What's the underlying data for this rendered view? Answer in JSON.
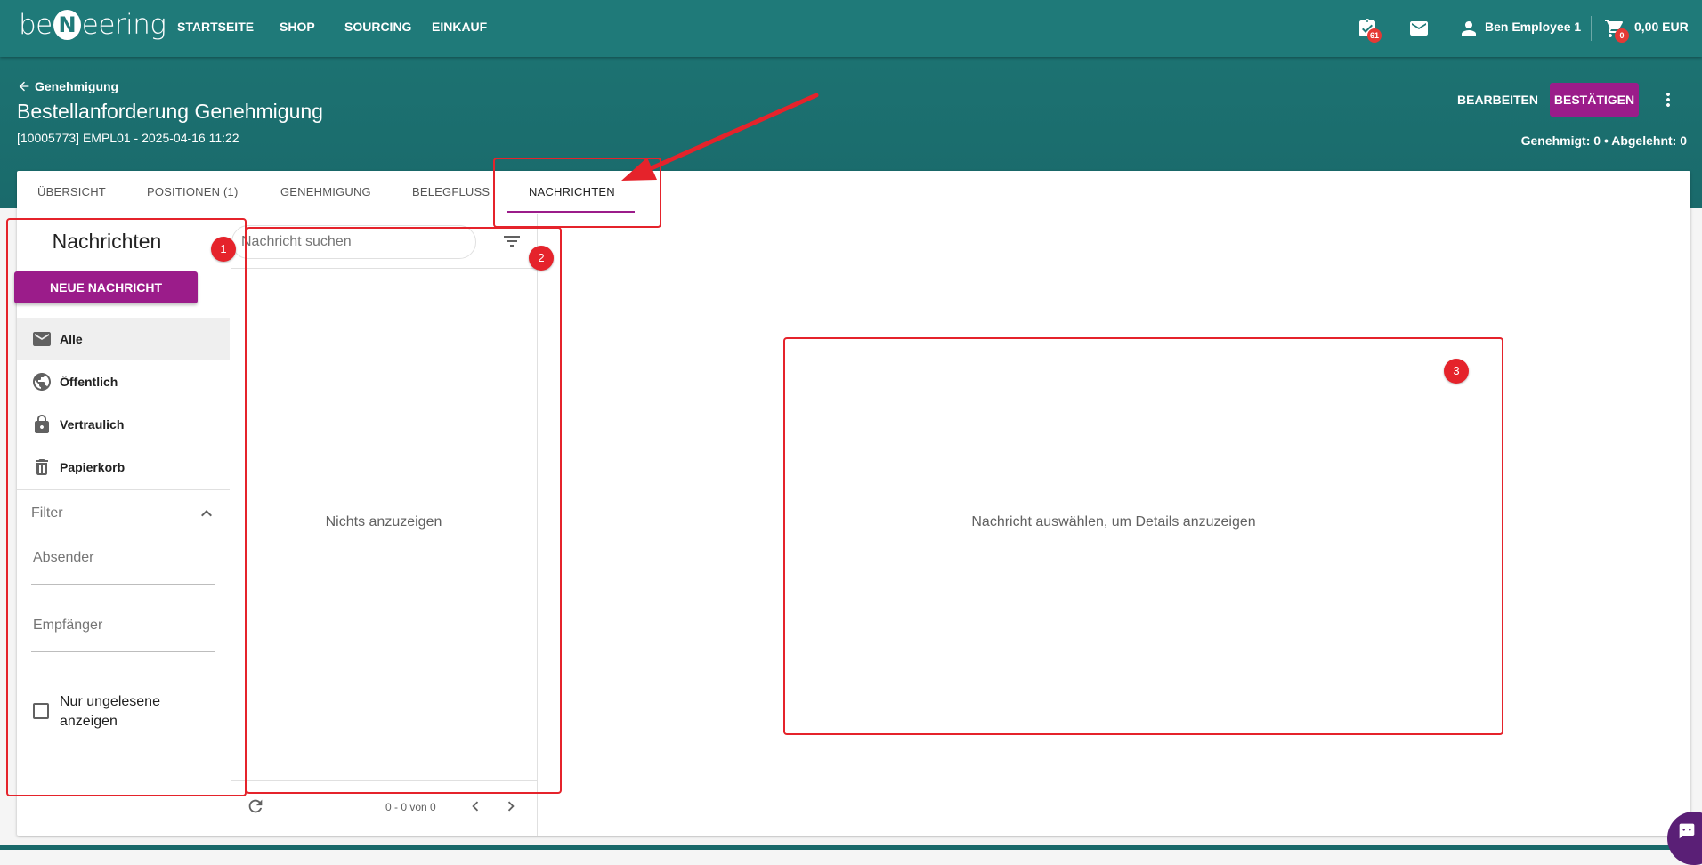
{
  "app": {
    "logo_left": "be",
    "logo_mid": "N",
    "logo_right": "eering"
  },
  "nav": {
    "items": [
      "STARTSEITE",
      "SHOP",
      "SOURCING",
      "EINKAUF"
    ],
    "approvals_badge": "61",
    "user_name": "Ben Employee 1",
    "cart_badge": "0",
    "cart_total": "0,00 EUR"
  },
  "header": {
    "back_label": "Genehmigung",
    "title": "Bestellanforderung Genehmigung",
    "subtitle": "[10005773] EMPL01 - 2025-04-16 11:22",
    "edit_label": "BEARBEITEN",
    "confirm_label": "BESTÄTIGEN",
    "approval_status": "Genehmigt: 0 • Abgelehnt: 0"
  },
  "tabs": [
    "ÜBERSICHT",
    "POSITIONEN (1)",
    "GENEHMIGUNG",
    "BELEGFLUSS",
    "NACHRICHTEN"
  ],
  "messages": {
    "section_title": "Nachrichten",
    "new_button": "NEUE NACHRICHT",
    "folders": [
      "Alle",
      "Öffentlich",
      "Vertraulich",
      "Papierkorb"
    ],
    "filter_title": "Filter",
    "sender_placeholder": "Absender",
    "recipient_placeholder": "Empfänger",
    "unread_only_label": "Nur ungelesene anzeigen",
    "search_placeholder": "Nachricht suchen",
    "list_empty": "Nichts anzuzeigen",
    "pager_count": "0 - 0 von 0",
    "detail_empty": "Nachricht auswählen, um Details anzuzeigen"
  },
  "annotations": [
    "1",
    "2",
    "3"
  ],
  "colors": {
    "header_teal": "#1f7a79",
    "accent_purple": "#9b1c8a",
    "annotation_red": "#e5232b",
    "badge_red": "#e53935"
  }
}
